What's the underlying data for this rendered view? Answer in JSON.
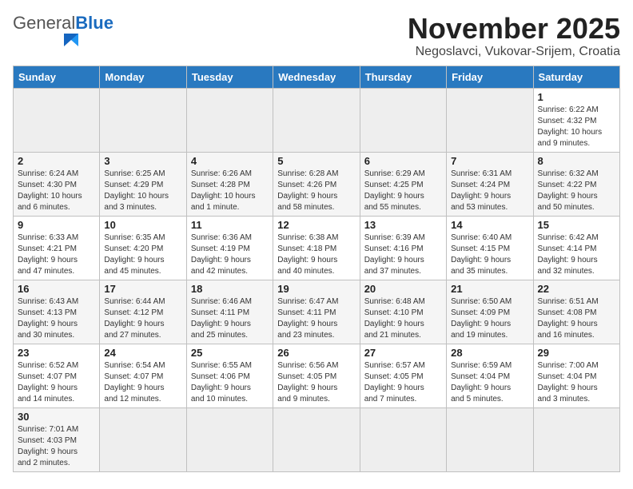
{
  "header": {
    "logo_general": "General",
    "logo_blue": "Blue",
    "month_title": "November 2025",
    "location": "Negoslavci, Vukovar-Srijem, Croatia"
  },
  "days_of_week": [
    "Sunday",
    "Monday",
    "Tuesday",
    "Wednesday",
    "Thursday",
    "Friday",
    "Saturday"
  ],
  "weeks": [
    [
      {
        "day": "",
        "info": ""
      },
      {
        "day": "",
        "info": ""
      },
      {
        "day": "",
        "info": ""
      },
      {
        "day": "",
        "info": ""
      },
      {
        "day": "",
        "info": ""
      },
      {
        "day": "",
        "info": ""
      },
      {
        "day": "1",
        "info": "Sunrise: 6:22 AM\nSunset: 4:32 PM\nDaylight: 10 hours\nand 9 minutes."
      }
    ],
    [
      {
        "day": "2",
        "info": "Sunrise: 6:24 AM\nSunset: 4:30 PM\nDaylight: 10 hours\nand 6 minutes."
      },
      {
        "day": "3",
        "info": "Sunrise: 6:25 AM\nSunset: 4:29 PM\nDaylight: 10 hours\nand 3 minutes."
      },
      {
        "day": "4",
        "info": "Sunrise: 6:26 AM\nSunset: 4:28 PM\nDaylight: 10 hours\nand 1 minute."
      },
      {
        "day": "5",
        "info": "Sunrise: 6:28 AM\nSunset: 4:26 PM\nDaylight: 9 hours\nand 58 minutes."
      },
      {
        "day": "6",
        "info": "Sunrise: 6:29 AM\nSunset: 4:25 PM\nDaylight: 9 hours\nand 55 minutes."
      },
      {
        "day": "7",
        "info": "Sunrise: 6:31 AM\nSunset: 4:24 PM\nDaylight: 9 hours\nand 53 minutes."
      },
      {
        "day": "8",
        "info": "Sunrise: 6:32 AM\nSunset: 4:22 PM\nDaylight: 9 hours\nand 50 minutes."
      }
    ],
    [
      {
        "day": "9",
        "info": "Sunrise: 6:33 AM\nSunset: 4:21 PM\nDaylight: 9 hours\nand 47 minutes."
      },
      {
        "day": "10",
        "info": "Sunrise: 6:35 AM\nSunset: 4:20 PM\nDaylight: 9 hours\nand 45 minutes."
      },
      {
        "day": "11",
        "info": "Sunrise: 6:36 AM\nSunset: 4:19 PM\nDaylight: 9 hours\nand 42 minutes."
      },
      {
        "day": "12",
        "info": "Sunrise: 6:38 AM\nSunset: 4:18 PM\nDaylight: 9 hours\nand 40 minutes."
      },
      {
        "day": "13",
        "info": "Sunrise: 6:39 AM\nSunset: 4:16 PM\nDaylight: 9 hours\nand 37 minutes."
      },
      {
        "day": "14",
        "info": "Sunrise: 6:40 AM\nSunset: 4:15 PM\nDaylight: 9 hours\nand 35 minutes."
      },
      {
        "day": "15",
        "info": "Sunrise: 6:42 AM\nSunset: 4:14 PM\nDaylight: 9 hours\nand 32 minutes."
      }
    ],
    [
      {
        "day": "16",
        "info": "Sunrise: 6:43 AM\nSunset: 4:13 PM\nDaylight: 9 hours\nand 30 minutes."
      },
      {
        "day": "17",
        "info": "Sunrise: 6:44 AM\nSunset: 4:12 PM\nDaylight: 9 hours\nand 27 minutes."
      },
      {
        "day": "18",
        "info": "Sunrise: 6:46 AM\nSunset: 4:11 PM\nDaylight: 9 hours\nand 25 minutes."
      },
      {
        "day": "19",
        "info": "Sunrise: 6:47 AM\nSunset: 4:11 PM\nDaylight: 9 hours\nand 23 minutes."
      },
      {
        "day": "20",
        "info": "Sunrise: 6:48 AM\nSunset: 4:10 PM\nDaylight: 9 hours\nand 21 minutes."
      },
      {
        "day": "21",
        "info": "Sunrise: 6:50 AM\nSunset: 4:09 PM\nDaylight: 9 hours\nand 19 minutes."
      },
      {
        "day": "22",
        "info": "Sunrise: 6:51 AM\nSunset: 4:08 PM\nDaylight: 9 hours\nand 16 minutes."
      }
    ],
    [
      {
        "day": "23",
        "info": "Sunrise: 6:52 AM\nSunset: 4:07 PM\nDaylight: 9 hours\nand 14 minutes."
      },
      {
        "day": "24",
        "info": "Sunrise: 6:54 AM\nSunset: 4:07 PM\nDaylight: 9 hours\nand 12 minutes."
      },
      {
        "day": "25",
        "info": "Sunrise: 6:55 AM\nSunset: 4:06 PM\nDaylight: 9 hours\nand 10 minutes."
      },
      {
        "day": "26",
        "info": "Sunrise: 6:56 AM\nSunset: 4:05 PM\nDaylight: 9 hours\nand 9 minutes."
      },
      {
        "day": "27",
        "info": "Sunrise: 6:57 AM\nSunset: 4:05 PM\nDaylight: 9 hours\nand 7 minutes."
      },
      {
        "day": "28",
        "info": "Sunrise: 6:59 AM\nSunset: 4:04 PM\nDaylight: 9 hours\nand 5 minutes."
      },
      {
        "day": "29",
        "info": "Sunrise: 7:00 AM\nSunset: 4:04 PM\nDaylight: 9 hours\nand 3 minutes."
      }
    ],
    [
      {
        "day": "30",
        "info": "Sunrise: 7:01 AM\nSunset: 4:03 PM\nDaylight: 9 hours\nand 2 minutes."
      },
      {
        "day": "",
        "info": ""
      },
      {
        "day": "",
        "info": ""
      },
      {
        "day": "",
        "info": ""
      },
      {
        "day": "",
        "info": ""
      },
      {
        "day": "",
        "info": ""
      },
      {
        "day": "",
        "info": ""
      }
    ]
  ]
}
